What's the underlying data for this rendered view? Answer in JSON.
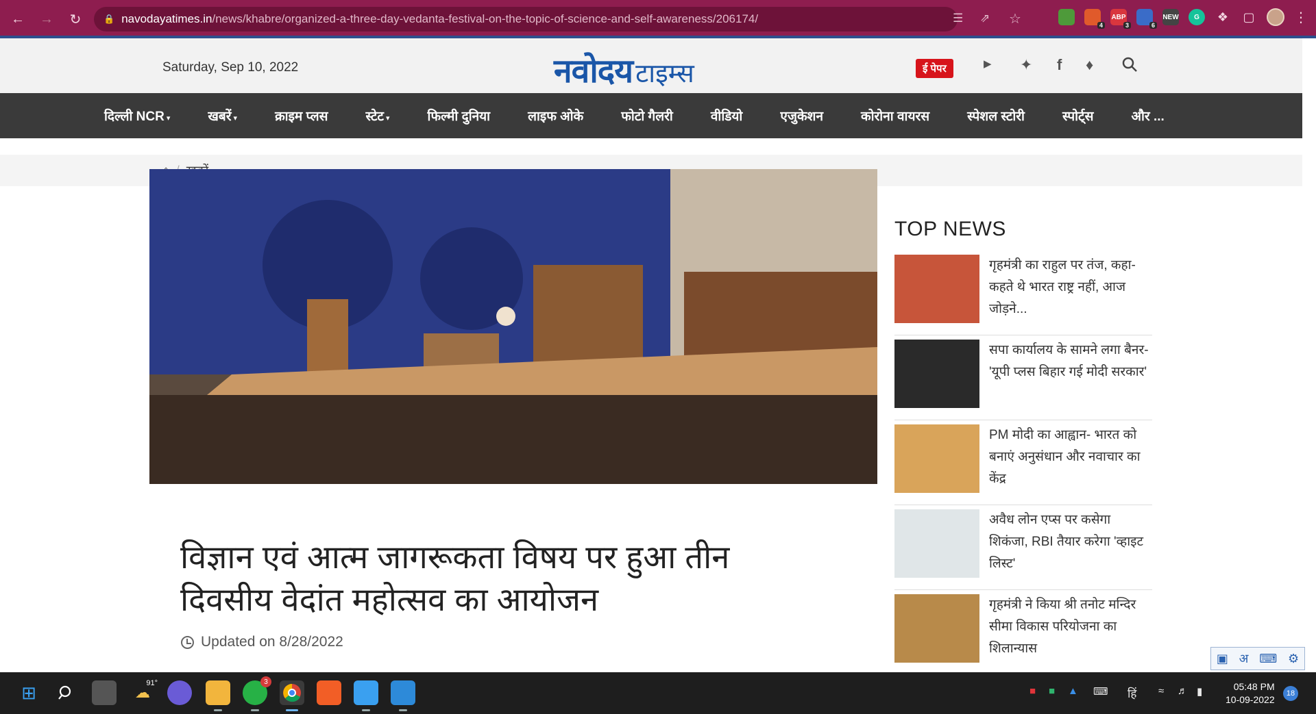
{
  "browser": {
    "url_host": "navodayatimes.in",
    "url_path": "/news/khabre/organized-a-three-day-vedanta-festival-on-the-topic-of-science-and-self-awareness/206174/",
    "extensions": [
      {
        "name": "extension-1",
        "color": "#4e9a3a",
        "badge": ""
      },
      {
        "name": "extension-2",
        "color": "#e05a2b",
        "badge": "4"
      },
      {
        "name": "adblock-plus",
        "color": "#d9363e",
        "label": "ABP",
        "badge": "3"
      },
      {
        "name": "extension-4",
        "color": "#3a6cc8",
        "badge": "6"
      },
      {
        "name": "extension-new",
        "color": "#444444",
        "label": "NEW",
        "badge": ""
      },
      {
        "name": "grammarly",
        "color": "#15c39a",
        "label": "G",
        "badge": ""
      }
    ]
  },
  "header": {
    "date": "Saturday, Sep 10, 2022",
    "logo_main": "नवोदय",
    "logo_sub": "टाइम्स",
    "epaper": "ई पेपर"
  },
  "nav": {
    "items": [
      {
        "label": "दिल्ली NCR",
        "dropdown": true
      },
      {
        "label": "खबरें",
        "dropdown": true
      },
      {
        "label": "क्राइम प्लस",
        "dropdown": false
      },
      {
        "label": "स्टेट",
        "dropdown": true
      },
      {
        "label": "फिल्मी दुनिया",
        "dropdown": false
      },
      {
        "label": "लाइफ ओके",
        "dropdown": false
      },
      {
        "label": "फोटो गैलरी",
        "dropdown": false
      },
      {
        "label": "वीडियो",
        "dropdown": false
      },
      {
        "label": "एजुकेशन",
        "dropdown": false
      },
      {
        "label": "कोरोना वायरस",
        "dropdown": false
      },
      {
        "label": "स्पेशल स्टोरी",
        "dropdown": false
      },
      {
        "label": "स्पोर्ट्स",
        "dropdown": false
      },
      {
        "label": "और ...",
        "dropdown": false
      }
    ]
  },
  "breadcrumb": {
    "separator": "/",
    "current": "खबरें"
  },
  "article": {
    "headline": "विज्ञान एवं आत्म जागरूकता विषय पर हुआ तीन दिवसीय वेदांत महोत्सव का आयोजन",
    "updated": "Updated on 8/28/2022"
  },
  "sidebar": {
    "title": "TOP NEWS",
    "items": [
      {
        "text": "गृहमंत्री का राहुल पर तंज, कहा- कहते थे भारत राष्ट्र नहीं, आज जोड़ने...",
        "thumb_color": "#c7553a"
      },
      {
        "text": "सपा कार्यालय के सामने लगा बैनर- 'यूपी प्लस बिहार गई मोदी सरकार'",
        "thumb_color": "#2a2a2a"
      },
      {
        "text": "PM मोदी का आह्वान-  भारत को बनाएं अनुसंधान और नवाचार का केंद्र",
        "thumb_color": "#d9a45a"
      },
      {
        "text": "अवैध लोन एप्स पर कसेगा शिकंजा, RBI तैयार करेगा 'व्हाइट लिस्ट'",
        "thumb_color": "#e0e6e8"
      },
      {
        "text": "गृहमंत्री ने किया श्री तनोट मन्दिर सीमा विकास परियोजना का शिलान्यास",
        "thumb_color": "#b88a4a"
      }
    ]
  },
  "taskbar": {
    "weather_temp": "91°",
    "whatsapp_badge": "3",
    "language": "हिं",
    "time": "05:48 PM",
    "date": "10-09-2022",
    "notifications": "18"
  }
}
